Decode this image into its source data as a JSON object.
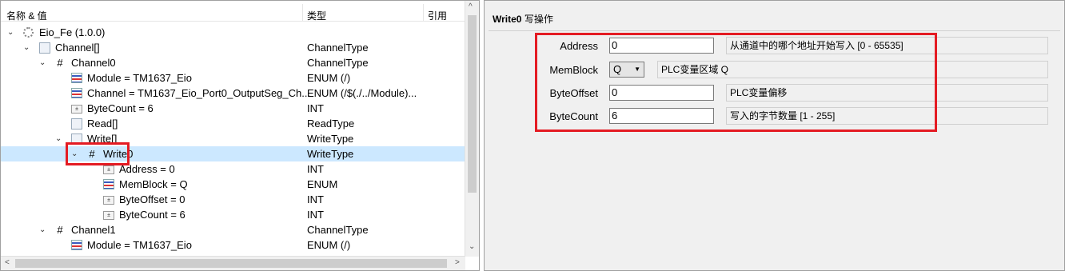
{
  "tree": {
    "headers": {
      "name": "名称 & 值",
      "type": "类型",
      "ref": "引用"
    },
    "rows": [
      {
        "label": "Eio_Fe (1.0.0)",
        "type": "",
        "icon": "gear-icon"
      },
      {
        "label": "Channel[]",
        "type": "ChannelType",
        "icon": "array-icon"
      },
      {
        "label": "Channel0",
        "type": "ChannelType",
        "icon": "struct-hash-icon"
      },
      {
        "label": "Module = TM1637_Eio",
        "type": "ENUM (/)",
        "icon": "enum-icon"
      },
      {
        "label": "Channel = TM1637_Eio_Port0_OutputSeg_Ch...",
        "type": "ENUM (/$(./../Module)...",
        "icon": "enum-icon"
      },
      {
        "label": "ByteCount = 6",
        "type": "INT",
        "icon": "int-icon"
      },
      {
        "label": "Read[]",
        "type": "ReadType",
        "icon": "array-icon"
      },
      {
        "label": "Write[]",
        "type": "WriteType",
        "icon": "array-icon"
      },
      {
        "label": "Write0",
        "type": "WriteType",
        "icon": "struct-hash-icon"
      },
      {
        "label": "Address = 0",
        "type": "INT",
        "icon": "int-icon"
      },
      {
        "label": "MemBlock = Q",
        "type": "ENUM",
        "icon": "enum-icon"
      },
      {
        "label": "ByteOffset = 0",
        "type": "INT",
        "icon": "int-icon"
      },
      {
        "label": "ByteCount = 6",
        "type": "INT",
        "icon": "int-icon"
      },
      {
        "label": "Channel1",
        "type": "ChannelType",
        "icon": "struct-hash-icon"
      },
      {
        "label": "Module = TM1637_Eio",
        "type": "ENUM (/)",
        "icon": "enum-icon"
      }
    ]
  },
  "panel": {
    "title_bold": "Write0",
    "title_rest": "写操作",
    "params": [
      {
        "label": "Address",
        "value": "0",
        "desc": "从通道中的哪个地址开始写入 [0 - 65535]"
      },
      {
        "label": "MemBlock",
        "value": "Q",
        "desc": "PLC变量区域 Q"
      },
      {
        "label": "ByteOffset",
        "value": "0",
        "desc": "PLC变量偏移"
      },
      {
        "label": "ByteCount",
        "value": "6",
        "desc": "写入的字节数量 [1 - 255]"
      }
    ]
  },
  "colors": {
    "highlight": "#e41b23",
    "selection": "#cce8ff"
  }
}
